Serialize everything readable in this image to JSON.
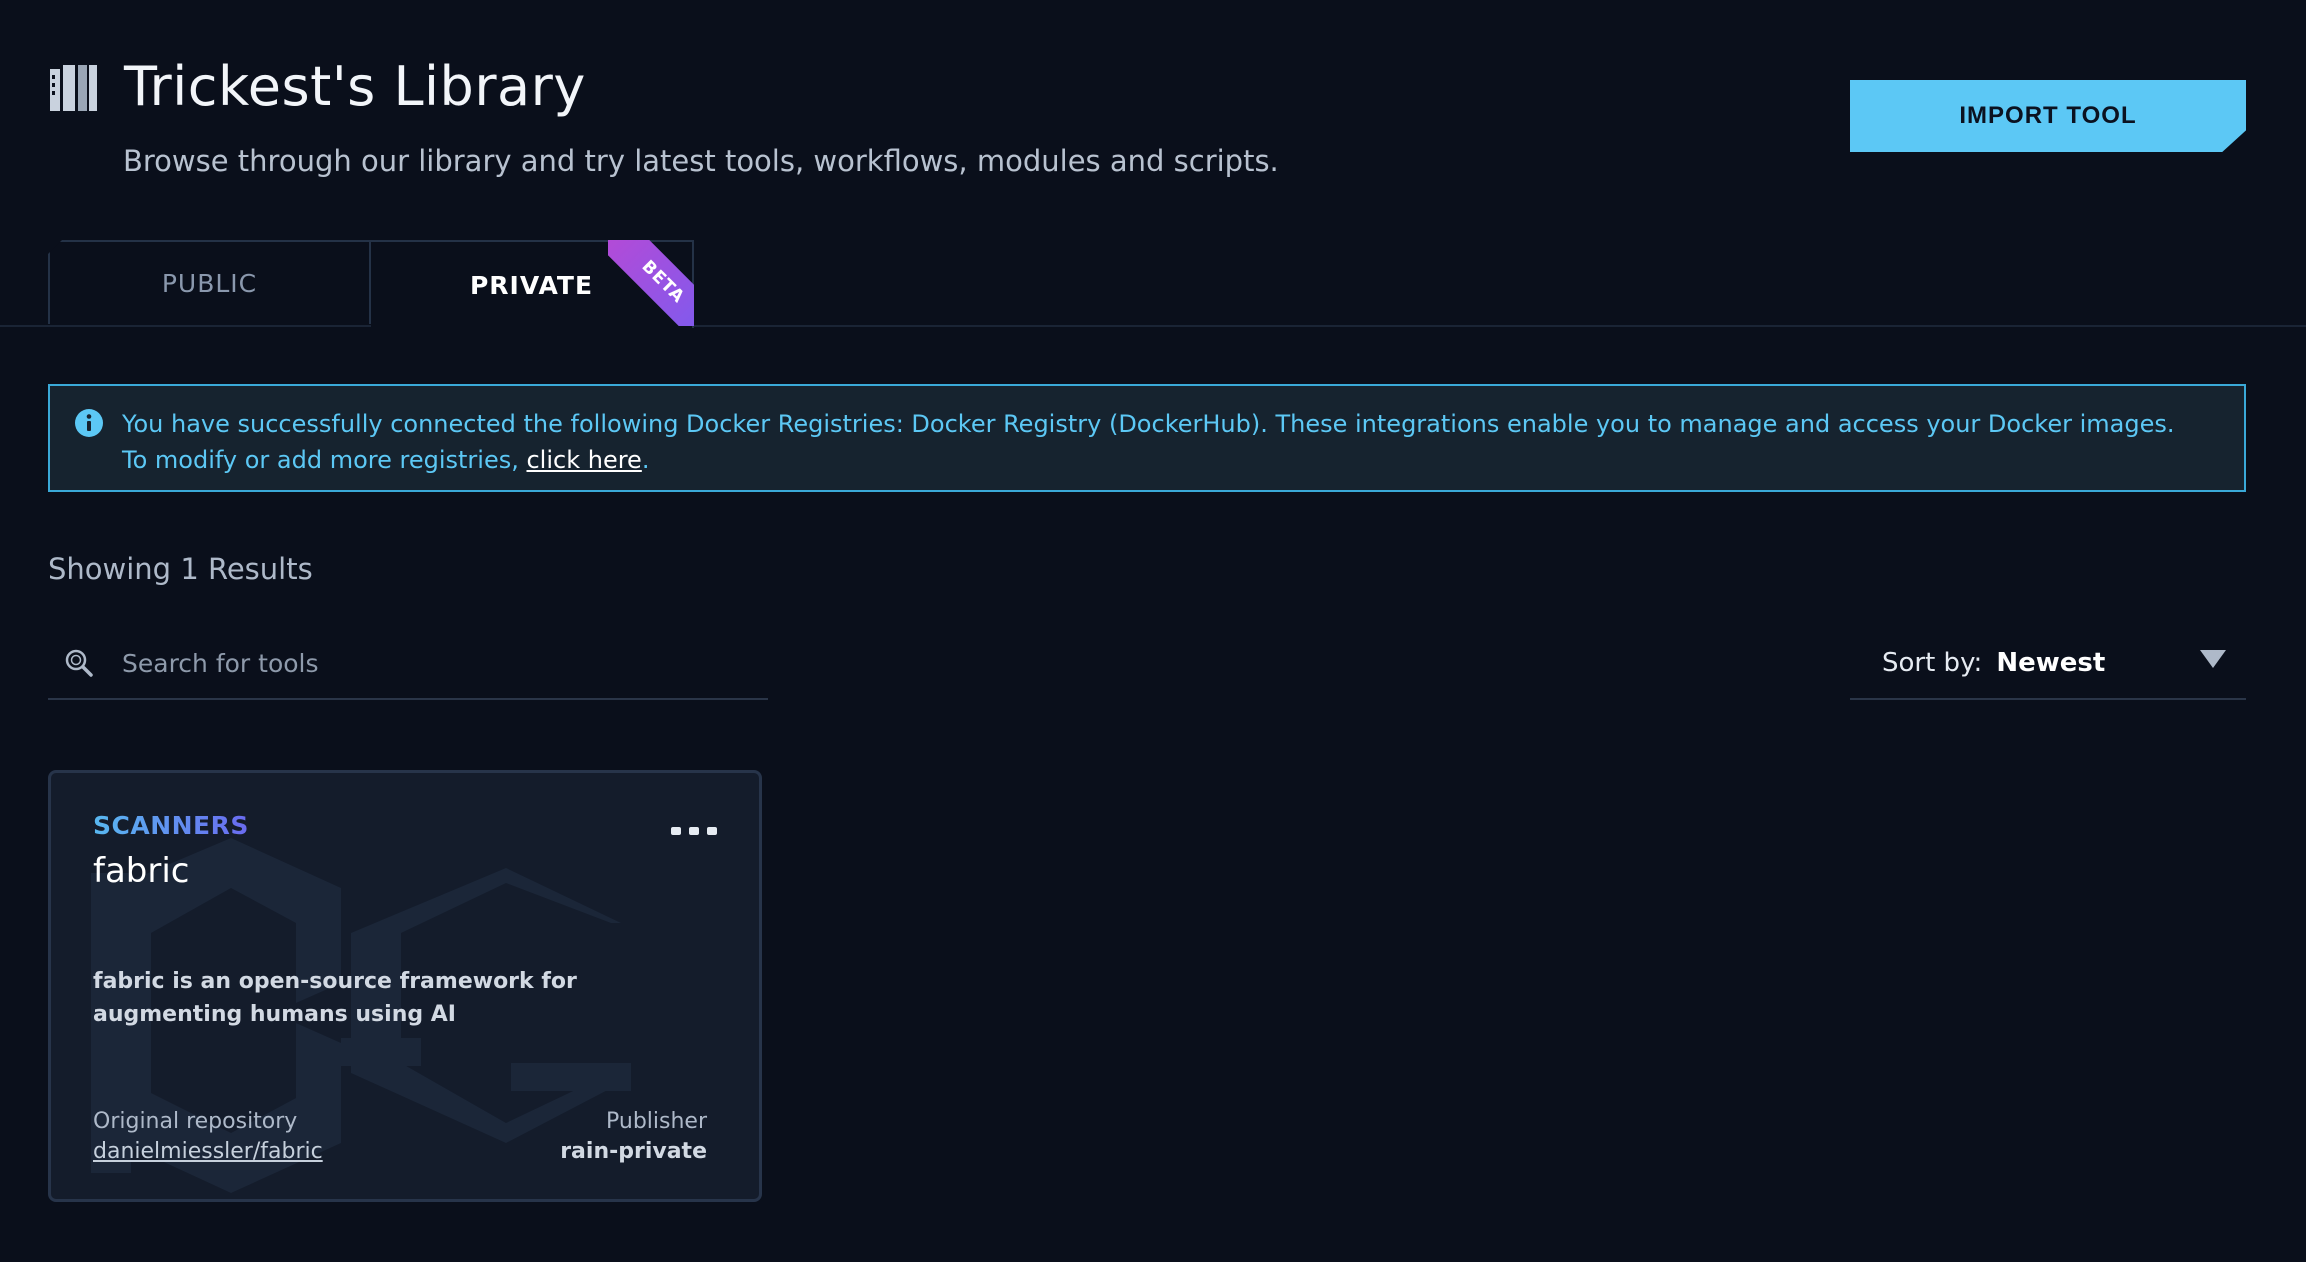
{
  "header": {
    "title": "Trickest's Library",
    "subtitle": "Browse through our library and try latest tools, workflows, modules and scripts.",
    "library_icon": "library-books-icon",
    "import_label": "IMPORT TOOL"
  },
  "tabs": [
    {
      "label": "PUBLIC",
      "active": false
    },
    {
      "label": "PRIVATE",
      "active": true,
      "badge": "BETA"
    }
  ],
  "info_banner": {
    "icon": "info-icon",
    "text": "You have successfully connected the following Docker Registries: Docker Registry (DockerHub). These integrations enable you to manage and access your Docker images. To modify or add more registries, ",
    "link_label": "click here",
    "suffix": "."
  },
  "results": {
    "count_text": "Showing 1 Results"
  },
  "search": {
    "icon": "search-icon",
    "placeholder": "Search for tools",
    "value": ""
  },
  "sort": {
    "label": "Sort by:",
    "value": "Newest",
    "icon": "caret-down-icon"
  },
  "cards": [
    {
      "category": "SCANNERS",
      "title": "fabric",
      "description": "fabric is an open-source framework for augmenting humans using AI",
      "repo_label": "Original repository",
      "repo_value": "danielmiessler/fabric",
      "publisher_label": "Publisher",
      "publisher_value": "rain-private"
    }
  ],
  "colors": {
    "background": "#0a0f1b",
    "accent": "#5cc8f5",
    "card_bg": "#141c2b",
    "beta_gradient_start": "#b54ad6",
    "beta_gradient_end": "#7a5cf0"
  }
}
